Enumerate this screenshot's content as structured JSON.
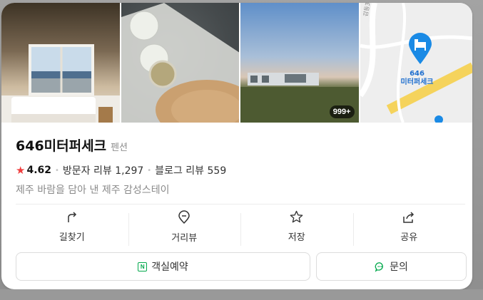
{
  "photos": {
    "count_badge": "999+",
    "map": {
      "place_label": "646\n미터퍼세크",
      "road_label": "감동3길"
    }
  },
  "place": {
    "name": "646미터퍼세크",
    "category": "펜션",
    "rating": "4.62",
    "visitor_reviews": "방문자 리뷰 1,297",
    "blog_reviews": "블로그 리뷰 559",
    "description": "제주 바람을 담아 낸 제주 감성스테이"
  },
  "actions": {
    "directions": "길찾기",
    "street_view": "거리뷰",
    "save": "저장",
    "share": "공유"
  },
  "buttons": {
    "book": "객실예약",
    "inquiry": "문의"
  },
  "colors": {
    "star": "#f03e3e",
    "naver_green": "#03a94d",
    "map_pin": "#1a8ae5"
  }
}
